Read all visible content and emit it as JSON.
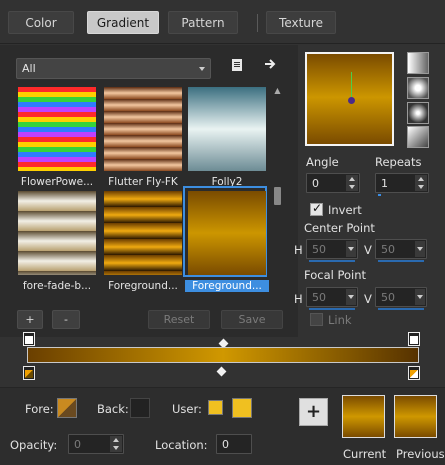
{
  "tabs": [
    {
      "label": "Color"
    },
    {
      "label": "Gradient",
      "active": true
    },
    {
      "label": "Pattern"
    },
    {
      "label": "Texture"
    }
  ],
  "library": {
    "filter_value": "All",
    "gradients": [
      {
        "label": "FlowerPowe...",
        "colors": [
          "#ff2a2a",
          "#ffd000",
          "#35d43a",
          "#2f7cff",
          "#c040ff"
        ]
      },
      {
        "label": "Flutter Fly-FK",
        "colors": [
          "#5a2a10",
          "#f3c7a0",
          "#8b4a20"
        ]
      },
      {
        "label": "Folly2",
        "colors": [
          "#3b6f80",
          "#e9f3f2",
          "#6d8c95"
        ]
      },
      {
        "label": "fore-fade-b...",
        "colors": [
          "#5a4a30",
          "#f2efe5",
          "#b8a070"
        ]
      },
      {
        "label": "Foreground...",
        "colors": [
          "#6a3c00",
          "#f0aa10",
          "#2a1600"
        ]
      },
      {
        "label": "Foreground...",
        "colors": [
          "#7a4b00",
          "#cc9600",
          "#7a4b00"
        ],
        "selected": true
      }
    ],
    "add_label": "+",
    "remove_label": "-",
    "reset_label": "Reset",
    "save_label": "Save"
  },
  "settings": {
    "angle_label": "Angle",
    "angle_value": "0",
    "repeats_label": "Repeats",
    "repeats_value": "1",
    "invert_label": "Invert",
    "invert_checked": true,
    "center_point_label": "Center Point",
    "center_h_label": "H",
    "center_h_value": "50",
    "center_v_label": "V",
    "center_v_value": "50",
    "focal_point_label": "Focal Point",
    "focal_h_label": "H",
    "focal_h_value": "50",
    "focal_v_label": "V",
    "focal_v_value": "50",
    "link_label": "Link",
    "link_checked": false
  },
  "editor": {
    "gradient_colors": [
      "#6a3f00",
      "#d09800",
      "#563200"
    ],
    "fore_label": "Fore:",
    "back_label": "Back:",
    "user_label": "User:",
    "user_color": "#f0c020",
    "opacity_label": "Opacity:",
    "opacity_value": "0",
    "location_label": "Location:",
    "location_value": "0",
    "current_label": "Current",
    "previous_label": "Previous"
  }
}
